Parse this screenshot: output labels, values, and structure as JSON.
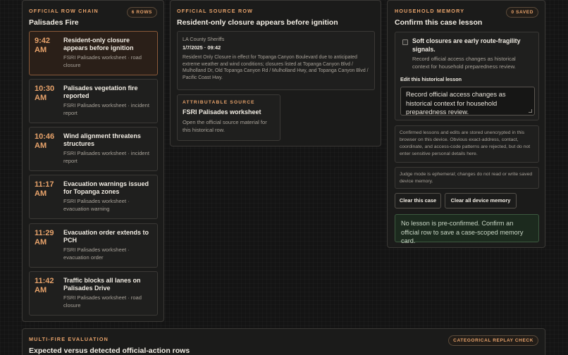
{
  "chain": {
    "eyebrow": "Official row chain",
    "title": "Palisades Fire",
    "count_badge": "6 rows",
    "rows": [
      {
        "time": "9:42 AM",
        "title": "Resident-only closure appears before ignition",
        "sub": "FSRI Palisades worksheet · road closure"
      },
      {
        "time": "10:30 AM",
        "title": "Palisades vegetation fire reported",
        "sub": "FSRI Palisades worksheet · incident report"
      },
      {
        "time": "10:46 AM",
        "title": "Wind alignment threatens structures",
        "sub": "FSRI Palisades worksheet · incident report"
      },
      {
        "time": "11:17 AM",
        "title": "Evacuation warnings issued for Topanga zones",
        "sub": "FSRI Palisades worksheet · evacuation warning"
      },
      {
        "time": "11:29 AM",
        "title": "Evacuation order extends to PCH",
        "sub": "FSRI Palisades worksheet · evacuation order"
      },
      {
        "time": "11:42 AM",
        "title": "Traffic blocks all lanes on Palisades Drive",
        "sub": "FSRI Palisades worksheet · road closure"
      }
    ]
  },
  "source": {
    "eyebrow": "Official source row",
    "title": "Resident-only closure appears before ignition",
    "org": "LA County Sheriffs",
    "date": "1/7/2025 · 09:42",
    "text": "Resident Only Closure in effect for Topanga Canyon Boulevard due to anticipated extreme weather and wind conditions; closures listed at Topanga Canyon Blvd / Mulholland Dr, Old Topanga Canyon Rd / Mulholland Hwy, and Topanga Canyon Blvd / Pacific Coast Hwy.",
    "attr_eyebrow": "Attributable source",
    "attr_title": "FSRI Palisades worksheet",
    "attr_text": "Open the official source material for this historical row."
  },
  "memory": {
    "eyebrow": "Household memory",
    "title": "Confirm this case lesson",
    "saved_badge": "0 saved",
    "lesson_title": "Soft closures are early route-fragility signals.",
    "lesson_sub": "Record official access changes as historical context for household preparedness review.",
    "edit_label": "Edit this historical lesson",
    "edit_value": "Record official access changes as historical context for household preparedness review.",
    "privacy_note": "Confirmed lessons and edits are stored unencrypted in this browser on this device. Obvious exact-address, contact, coordinate, and access-code patterns are rejected, but do not enter sensitive personal details here.",
    "judge_note": "Judge mode is ephemeral; changes do not read or write saved device memory.",
    "clear_case_label": "Clear this case",
    "clear_all_label": "Clear all device memory",
    "status": "No lesson is pre-confirmed. Confirm an official row to save a case-scoped memory card."
  },
  "evaluation": {
    "eyebrow": "Multi-fire evaluation",
    "title": "Expected versus detected official-action rows",
    "badge": "Categorical replay check"
  }
}
